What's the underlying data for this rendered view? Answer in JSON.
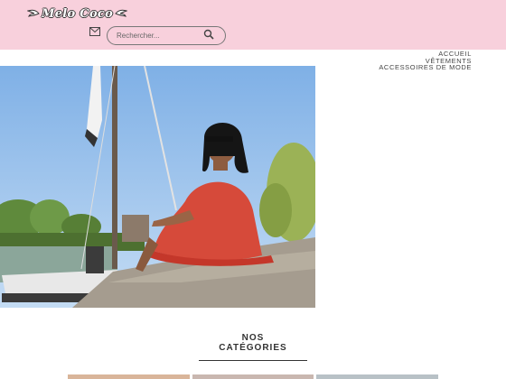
{
  "header": {
    "logo_text": "Melo Coco",
    "colors": {
      "background": "#f8d0dc",
      "text": "#444444"
    }
  },
  "icons": {
    "mail": "mail-icon",
    "search": "search-icon",
    "logo_wings": "wing-icon"
  },
  "search": {
    "placeholder": "Rechercher..."
  },
  "nav": {
    "items": [
      {
        "label": "ACCUEIL"
      },
      {
        "label": "VÊTEMENTS"
      },
      {
        "label": "ACCESSOIRES DE MODE"
      }
    ]
  },
  "categories": {
    "title": "NOS CATÉGORIES",
    "thumb_colors": [
      "#d9b59a",
      "#c9b7b0",
      "#b8c1c6"
    ]
  }
}
